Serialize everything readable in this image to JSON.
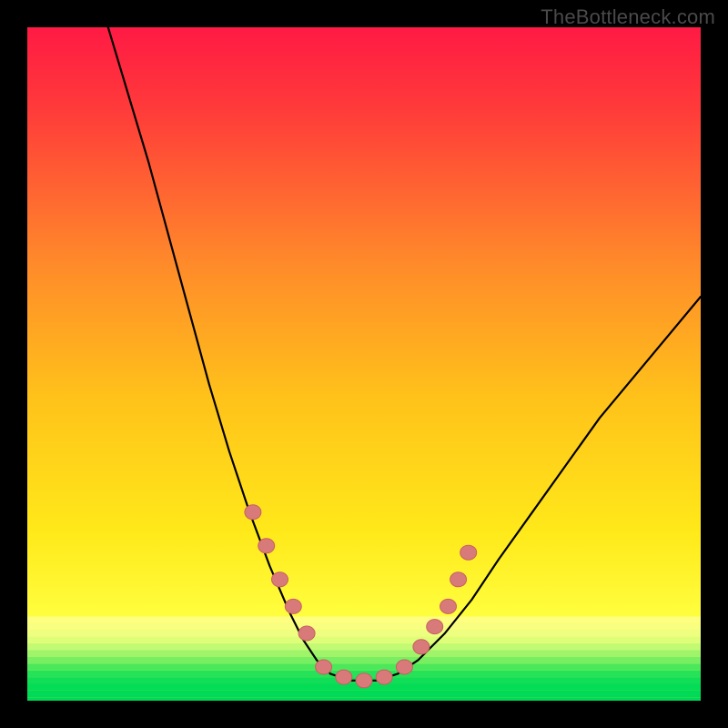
{
  "watermark": "TheBottleneck.com",
  "colors": {
    "frame_bg": "#000000",
    "grad_top": "#ff1a44",
    "grad_mid": "#ffd400",
    "grad_green_band": "#ffff7a",
    "grad_bottom": "#00e060",
    "curve": "#000000",
    "marker_fill": "#d87a7a",
    "marker_stroke": "#c86060",
    "watermark": "#4a4a4a"
  },
  "chart_data": {
    "type": "line",
    "title": "",
    "xlabel": "",
    "ylabel": "",
    "xlim": [
      0,
      100
    ],
    "ylim": [
      0,
      100
    ],
    "series": [
      {
        "name": "left-curve",
        "x": [
          12,
          15,
          18,
          21,
          24,
          27,
          30,
          33,
          36,
          39,
          41,
          43,
          45
        ],
        "y": [
          100,
          90,
          80,
          69,
          58,
          47,
          37,
          28,
          20,
          13,
          9,
          6,
          4
        ]
      },
      {
        "name": "trough",
        "x": [
          45,
          48,
          52,
          55
        ],
        "y": [
          4,
          3,
          3,
          4
        ]
      },
      {
        "name": "right-curve",
        "x": [
          55,
          58,
          62,
          66,
          70,
          75,
          80,
          85,
          90,
          95,
          100
        ],
        "y": [
          4,
          6,
          10,
          15,
          21,
          28,
          35,
          42,
          48,
          54,
          60
        ]
      }
    ],
    "markers": {
      "name": "highlight-dots",
      "x": [
        33.5,
        35.5,
        37.5,
        39.5,
        41.5,
        44,
        47,
        50,
        53,
        56,
        58.5,
        60.5,
        62.5,
        64,
        65.5
      ],
      "y": [
        28,
        23,
        18,
        14,
        10,
        5,
        3.5,
        3,
        3.5,
        5,
        8,
        11,
        14,
        18,
        22
      ]
    },
    "bottom_bands": [
      {
        "y": 12,
        "color": "#fefe80"
      },
      {
        "y": 11,
        "color": "#f8fe80"
      },
      {
        "y": 10,
        "color": "#eefe80"
      },
      {
        "y": 9,
        "color": "#defe7a"
      },
      {
        "y": 8,
        "color": "#c2fa74"
      },
      {
        "y": 7,
        "color": "#a0f46a"
      },
      {
        "y": 6,
        "color": "#78ee62"
      },
      {
        "y": 5,
        "color": "#4ce85c"
      },
      {
        "y": 4,
        "color": "#26e258"
      },
      {
        "y": 3,
        "color": "#10de56"
      },
      {
        "y": 2,
        "color": "#04dc56"
      },
      {
        "y": 1,
        "color": "#00da56"
      },
      {
        "y": 0,
        "color": "#00d856"
      }
    ]
  }
}
